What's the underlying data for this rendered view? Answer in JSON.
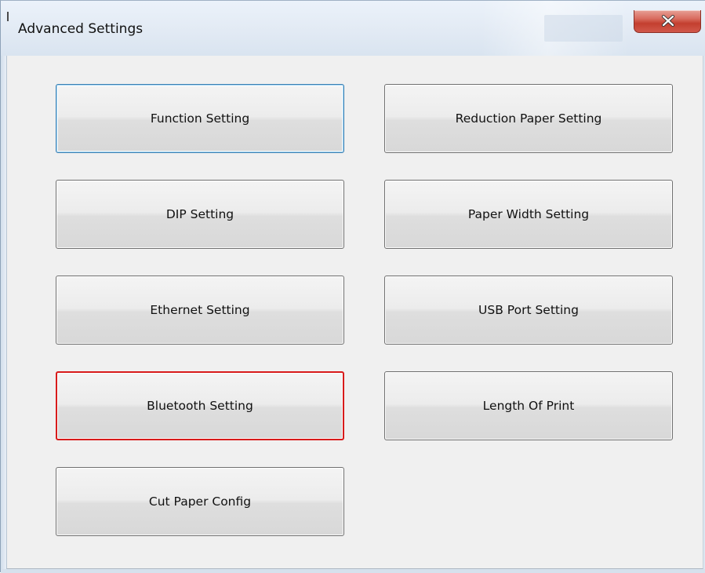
{
  "window": {
    "title": "Advanced Settings",
    "close_icon": "close-x-icon"
  },
  "buttons": {
    "function_setting": "Function Setting",
    "reduction_paper_setting": "Reduction Paper Setting",
    "dip_setting": "DIP Setting",
    "paper_width_setting": "Paper Width Setting",
    "ethernet_setting": "Ethernet Setting",
    "usb_port_setting": "USB Port Setting",
    "bluetooth_setting": "Bluetooth Setting",
    "length_of_print": "Length Of Print",
    "cut_paper_config": "Cut Paper Config"
  },
  "colors": {
    "focus_border": "#3c7fb1",
    "highlight_border": "#d81b1b",
    "close_button": "#c33f2f"
  }
}
